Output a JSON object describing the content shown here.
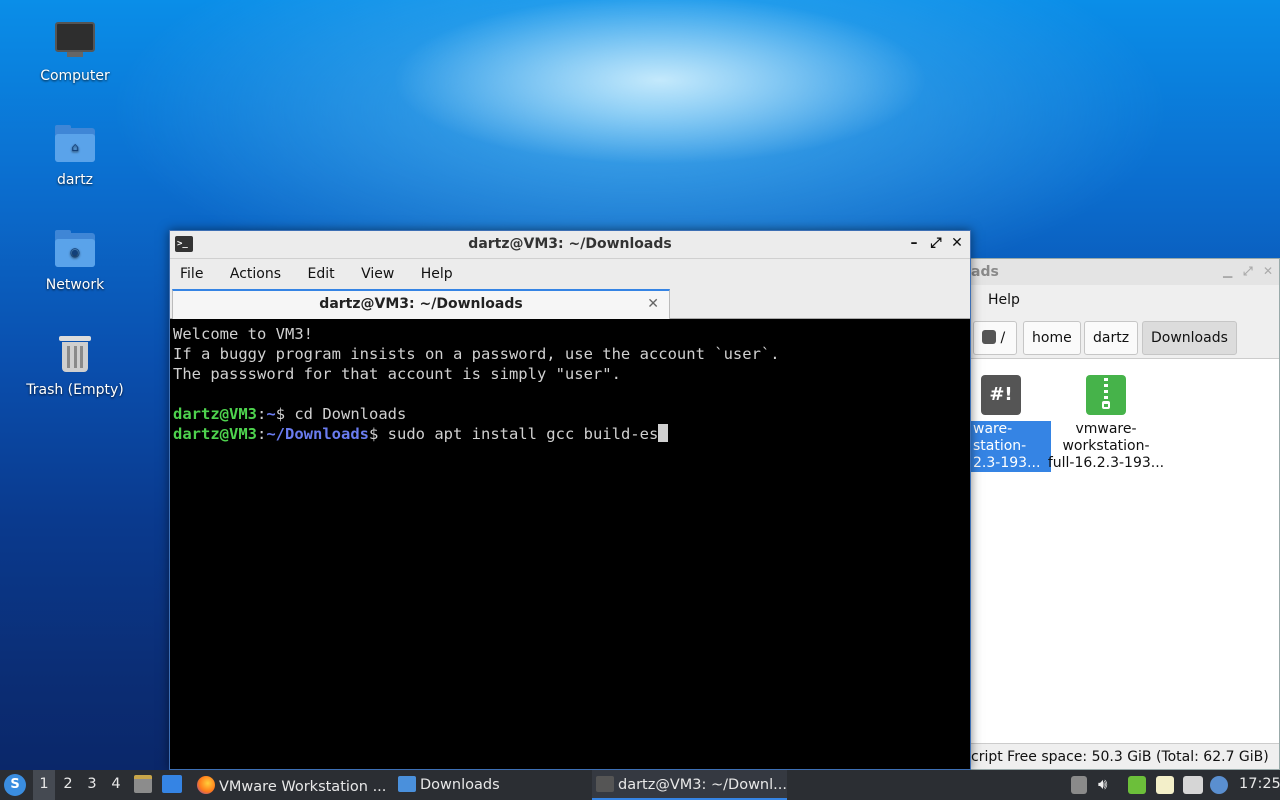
{
  "desktop": {
    "icons": [
      {
        "label": "Computer"
      },
      {
        "label": "dartz"
      },
      {
        "label": "Network"
      },
      {
        "label": "Trash (Empty)"
      }
    ]
  },
  "file_manager": {
    "title_fragment": "ads",
    "menu": {
      "help": "Help"
    },
    "path": {
      "root": "/",
      "crumbs": [
        "home",
        "dartz",
        "Downloads"
      ]
    },
    "files": [
      {
        "name_lines": [
          "ware-",
          "station-",
          "2.3-193..."
        ],
        "selected": true
      },
      {
        "name_lines": [
          "vmware-",
          "workstation-",
          "full-16.2.3-193..."
        ],
        "selected": false
      }
    ],
    "status": "cript  Free space: 50.3 GiB (Total: 62.7 GiB)"
  },
  "terminal": {
    "title": "dartz@VM3: ~/Downloads",
    "menu": [
      "File",
      "Actions",
      "Edit",
      "View",
      "Help"
    ],
    "tab_title": "dartz@VM3: ~/Downloads",
    "lines": {
      "l1": "Welcome to VM3!",
      "l2": "If a buggy program insists on a password, use the account `user`.",
      "l3": "The passsword for that account is simply \"user\".",
      "prompt1_user": "dartz@VM3",
      "prompt1_path": "~",
      "prompt1_cmd": "$ cd Downloads",
      "prompt2_user": "dartz@VM3",
      "prompt2_path": "~/Downloads",
      "prompt2_cmd": "$ sudo apt install gcc build-es"
    }
  },
  "taskbar": {
    "workspaces": [
      "1",
      "2",
      "3",
      "4"
    ],
    "active_workspace": "1",
    "tasks": [
      {
        "label": "VMware Workstation ..."
      },
      {
        "label": "Downloads"
      },
      {
        "label": "dartz@VM3: ~/Downl..."
      }
    ],
    "clock": "17:25"
  }
}
